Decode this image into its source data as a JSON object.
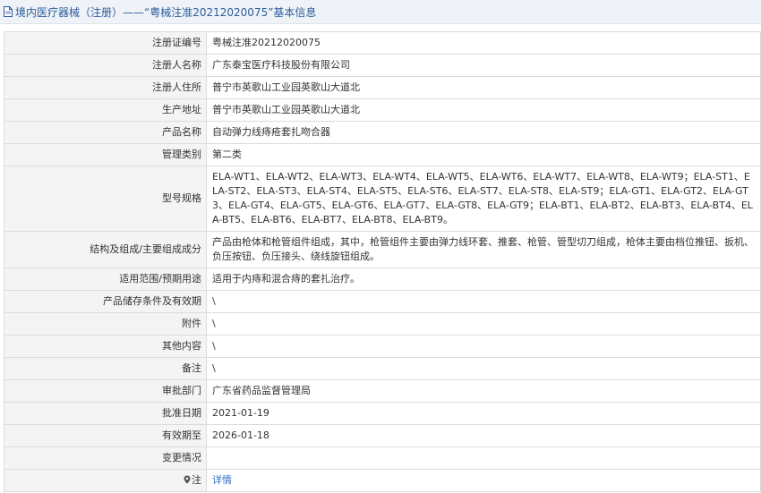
{
  "header": {
    "title": "境内医疗器械（注册）——“粤械注准20212020075”基本信息"
  },
  "rows": [
    {
      "label": "注册证编号",
      "value": "粤械注准20212020075"
    },
    {
      "label": "注册人名称",
      "value": "广东泰宝医疗科技股份有限公司"
    },
    {
      "label": "注册人住所",
      "value": "普宁市英歌山工业园英歌山大道北"
    },
    {
      "label": "生产地址",
      "value": "普宁市英歌山工业园英歌山大道北"
    },
    {
      "label": "产品名称",
      "value": "自动弹力线痔疮套扎吻合器"
    },
    {
      "label": "管理类别",
      "value": "第二类"
    },
    {
      "label": "型号规格",
      "value": "ELA-WT1、ELA-WT2、ELA-WT3、ELA-WT4、ELA-WT5、ELA-WT6、ELA-WT7、ELA-WT8、ELA-WT9；ELA-ST1、ELA-ST2、ELA-ST3、ELA-ST4、ELA-ST5、ELA-ST6、ELA-ST7、ELA-ST8、ELA-ST9；ELA-GT1、ELA-GT2、ELA-GT3、ELA-GT4、ELA-GT5、ELA-GT6、ELA-GT7、ELA-GT8、ELA-GT9；ELA-BT1、ELA-BT2、ELA-BT3、ELA-BT4、ELA-BT5、ELA-BT6、ELA-BT7、ELA-BT8、ELA-BT9。"
    },
    {
      "label": "结构及组成/主要组成成分",
      "value": "产品由枪体和枪管组件组成，其中，枪管组件主要由弹力线环套、推套、枪管、管型切刀组成，枪体主要由档位推钮、扳机、负压按钮、负压接头、绕线旋钮组成。"
    },
    {
      "label": "适用范围/预期用途",
      "value": "适用于内痔和混合痔的套扎治疗。"
    },
    {
      "label": "产品储存条件及有效期",
      "value": "\\"
    },
    {
      "label": "附件",
      "value": "\\"
    },
    {
      "label": "其他内容",
      "value": "\\"
    },
    {
      "label": "备注",
      "value": "\\"
    },
    {
      "label": "审批部门",
      "value": "广东省药品监督管理局"
    },
    {
      "label": "批准日期",
      "value": "2021-01-19"
    },
    {
      "label": "有效期至",
      "value": "2026-01-18"
    },
    {
      "label": "变更情况",
      "value": ""
    }
  ],
  "note_row": {
    "label": "注",
    "link_text": "详情",
    "pin_icon": "location-pin-icon"
  },
  "colors": {
    "title_bg": "#eff3f8",
    "title_text": "#2b5c9a",
    "label_bg": "#f4f4f4",
    "border": "#dcdcdc",
    "link": "#2f6fc0"
  }
}
